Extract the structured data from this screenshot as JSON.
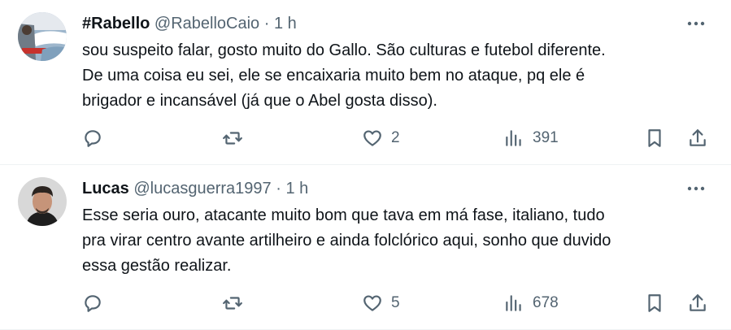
{
  "tweets": [
    {
      "name": "#Rabello",
      "handle": "@RabelloCaio",
      "separator": "·",
      "time": "1 h",
      "text_lines": [
        "sou suspeito falar, gosto muito do Gallo. São culturas e futebol diferente.",
        "De uma coisa eu sei, ele se encaixaria muito bem no ataque, pq ele é",
        "brigador e incansável (já que o Abel gosta disso)."
      ],
      "likes": "2",
      "views": "391",
      "avatar_colors": [
        "#6f7b86",
        "#e5e9ee",
        "#c7322c",
        "#9db6cc"
      ]
    },
    {
      "name": "Lucas",
      "handle": "@lucasguerra1997",
      "separator": "·",
      "time": "1 h",
      "text_lines": [
        "Esse seria ouro, atacante muito bom que tava em má fase, italiano, tudo",
        "pra virar centro avante artilheiro e ainda folclórico aqui, sonho que duvido",
        "essa gestão realizar."
      ],
      "likes": "5",
      "views": "678",
      "avatar_colors": [
        "#d8d8d8",
        "#2b2420",
        "#c69479",
        "#1e1e1e"
      ]
    }
  ],
  "icons": {
    "more": "more-dots-icon",
    "reply": "reply-bubble-icon",
    "retweet": "retweet-icon",
    "like": "heart-icon",
    "views": "views-bars-icon",
    "bookmark": "bookmark-icon",
    "share": "share-icon"
  },
  "colors": {
    "text": "#0f1419",
    "secondary": "#536471",
    "divider": "#eff3f4"
  }
}
